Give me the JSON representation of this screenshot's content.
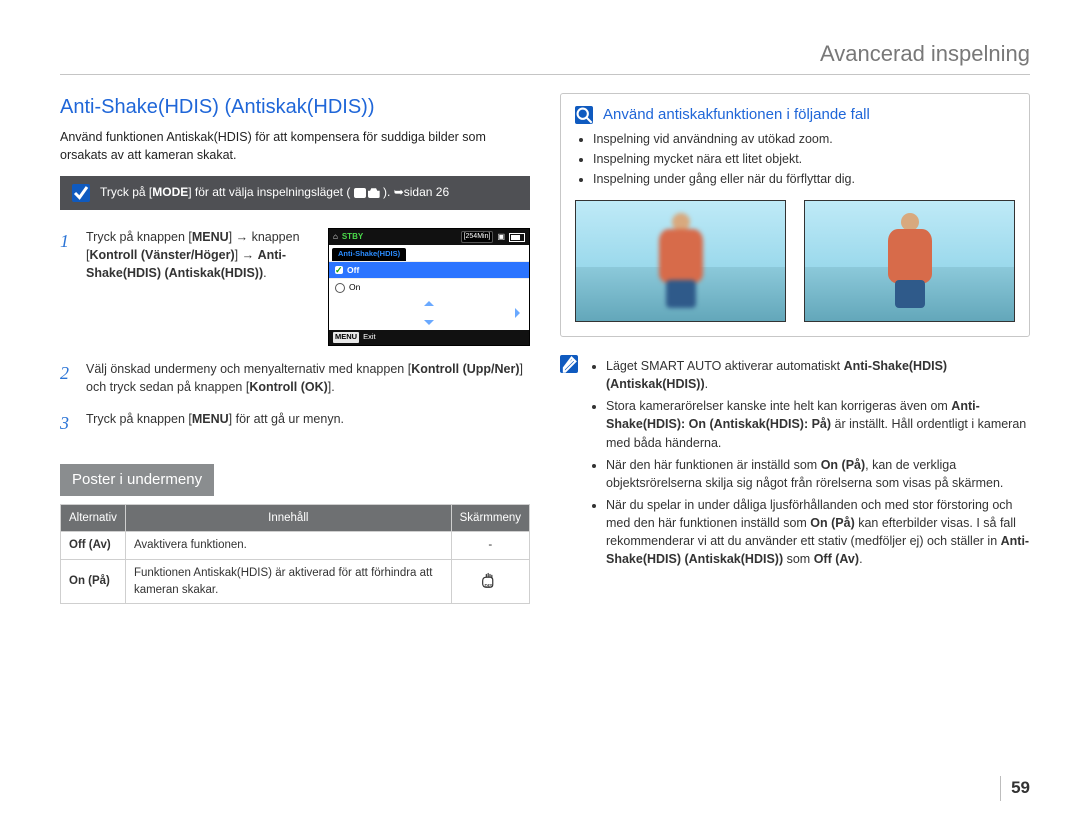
{
  "header": {
    "section": "Avancerad inspelning"
  },
  "left": {
    "title": "Anti-Shake(HDIS) (Antiskak(HDIS))",
    "intro": "Använd funktionen Antiskak(HDIS) för att kompensera för suddiga bilder som orsakats av att kameran skakat.",
    "modebar": {
      "pre": "Tryck på [",
      "mode": "MODE",
      "post": "] för att välja inspelningsläget (",
      "tail": ").  ",
      "pageref": "➥sidan 26"
    },
    "steps": {
      "s1": {
        "a": "Tryck på knappen [",
        "menu": "MENU",
        "b": "] → knappen [",
        "ctrl": "Kontroll (Vänster/Höger)",
        "c": "] → ",
        "opt": "Anti-Shake(HDIS) (Antiskak(HDIS))",
        "d": "."
      },
      "s2": {
        "a": "Välj önskad undermeny och menyalternativ med knappen [",
        "updown": "Kontroll (Upp/Ner)",
        "b": "] och tryck sedan på knappen [",
        "ok": "Kontroll (OK)",
        "c": "]."
      },
      "s3": {
        "a": "Tryck på knappen [",
        "menu": "MENU",
        "b": "] för att gå ur menyn."
      }
    },
    "lcd": {
      "stby": "STBY",
      "time": "[254Min]",
      "tab": "Anti-Shake(HDIS)",
      "off": "Off",
      "on": "On",
      "menu": "MENU",
      "exit": "Exit"
    },
    "subhead": "Poster i undermeny",
    "table": {
      "h1": "Alternativ",
      "h2": "Innehåll",
      "h3": "Skärmmeny",
      "r1": {
        "opt": "Off (Av)",
        "txt": "Avaktivera funktionen.",
        "icon": "-"
      },
      "r2": {
        "opt": "On (På)",
        "txt": "Funktionen Antiskak(HDIS) är aktiverad för att förhindra att kameran skakar."
      }
    }
  },
  "right": {
    "box": {
      "title": "Använd antiskakfunktionen i följande fall",
      "items": [
        "Inspelning vid användning av utökad zoom.",
        "Inspelning mycket nära ett litet objekt.",
        "Inspelning under gång eller när du förflyttar dig."
      ]
    },
    "notes": {
      "n1a": "Läget SMART AUTO aktiverar automatiskt ",
      "n1b": "Anti-Shake(HDIS) (Antiskak(HDIS))",
      "n1c": ".",
      "n2a": "Stora kamerarörelser kanske inte helt kan korrigeras även om ",
      "n2b": "Anti-Shake(HDIS): On (Antiskak(HDIS): På)",
      "n2c": " är inställt. Håll ordentligt i kameran med båda händerna.",
      "n3a": "När den här funktionen är inställd som ",
      "n3b": "On (På)",
      "n3c": ", kan de verkliga objektsrörelserna skilja sig något från rörelserna som visas på skärmen.",
      "n4a": "När du spelar in under dåliga ljusförhållanden och med stor förstoring och med den här funktionen inställd som ",
      "n4b": "On (På)",
      "n4c": " kan efterbilder visas. I så fall rekommenderar vi att du använder ett stativ (medföljer ej) och ställer in ",
      "n4d": "Anti-Shake(HDIS) (Antiskak(HDIS))",
      "n4e": " som ",
      "n4f": "Off (Av)",
      "n4g": "."
    }
  },
  "page": "59"
}
